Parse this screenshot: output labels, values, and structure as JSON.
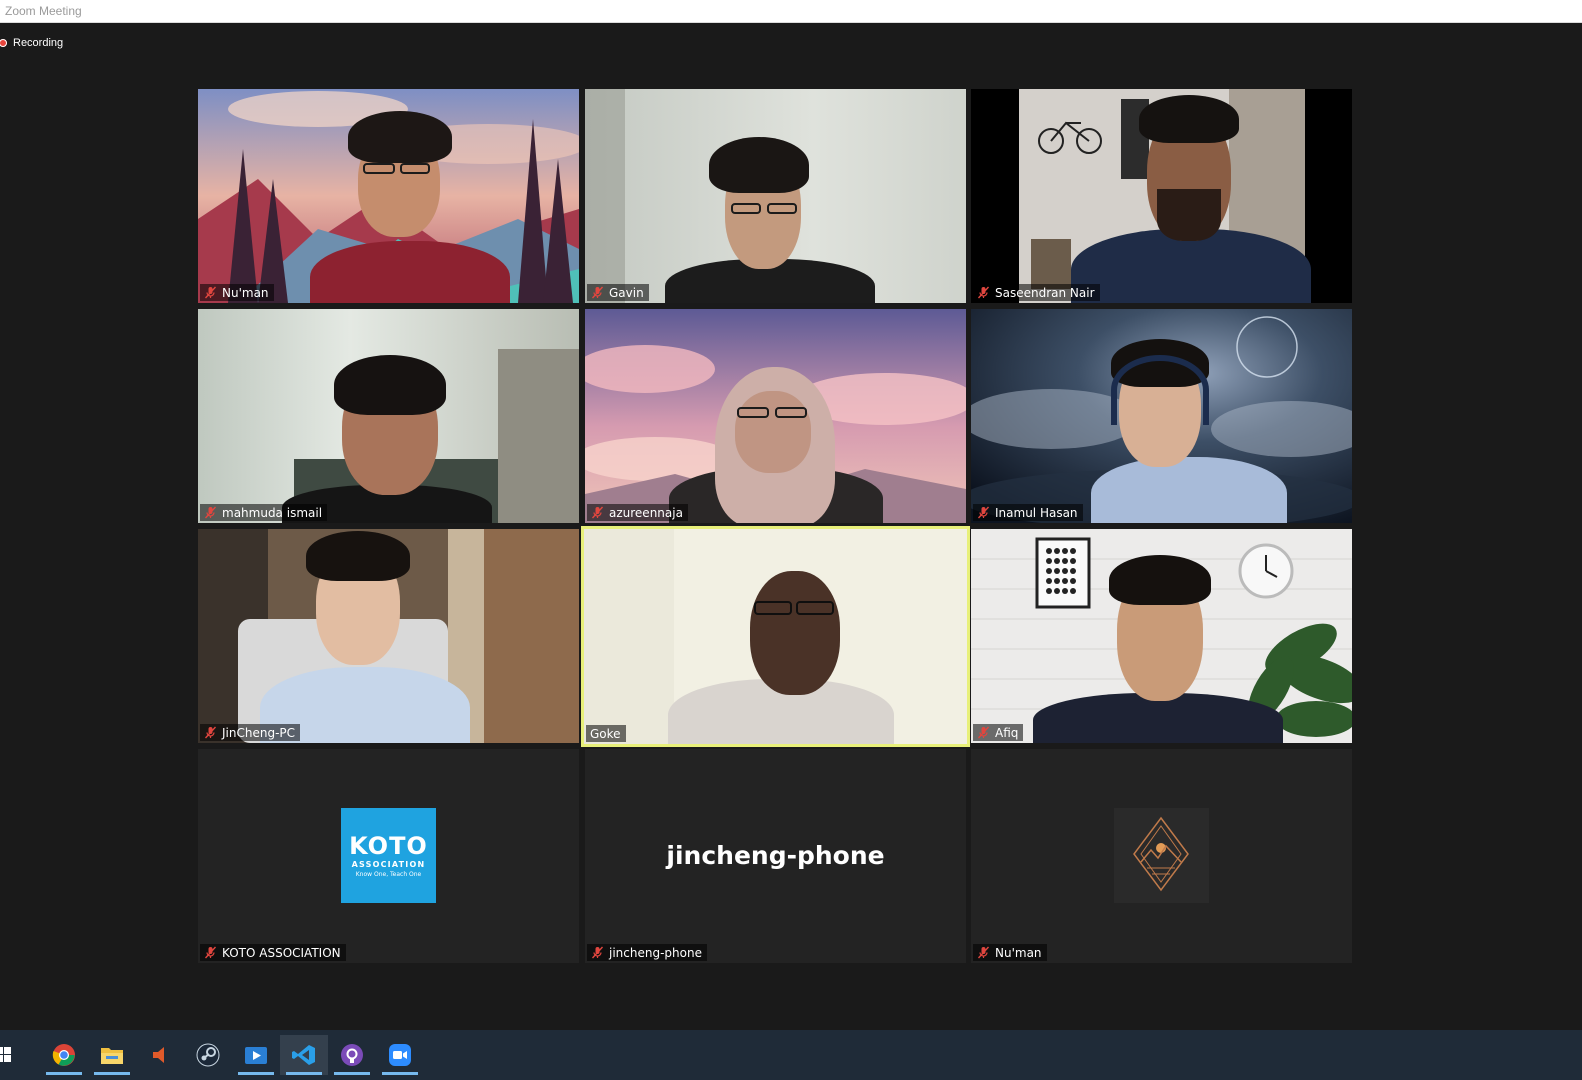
{
  "window": {
    "title": "Zoom Meeting"
  },
  "recording": {
    "label": "Recording"
  },
  "participants": [
    {
      "name": "Nu'man"
    },
    {
      "name": "Gavin"
    },
    {
      "name": "Saseendran Nair"
    },
    {
      "name": "mahmuda ismail"
    },
    {
      "name": "azureennaja"
    },
    {
      "name": "Inamul Hasan"
    },
    {
      "name": "JinCheng-PC"
    },
    {
      "name": "Goke"
    },
    {
      "name": "Afiq"
    },
    {
      "name": "KOTO ASSOCIATION"
    },
    {
      "name": "jincheng-phone"
    },
    {
      "name": "Nu'man"
    }
  ],
  "koto_logo": {
    "line1": "KOTO",
    "line2": "ASSOCIATION",
    "line3": "Know One, Teach One"
  },
  "phone_tile": {
    "display_text": "jincheng-phone"
  },
  "colors": {
    "active_speaker_border": "#e8f07a",
    "koto_blue": "#1fa3e0",
    "mic_muted": "#e0463f",
    "taskbar": "#1f2b38"
  },
  "taskbar": {
    "items": [
      {
        "icon": "windows-start-icon"
      },
      {
        "icon": "chrome-icon"
      },
      {
        "icon": "file-explorer-icon"
      },
      {
        "icon": "audio-app-icon"
      },
      {
        "icon": "steam-icon"
      },
      {
        "icon": "media-player-icon"
      },
      {
        "icon": "vscode-icon"
      },
      {
        "icon": "github-desktop-icon"
      },
      {
        "icon": "zoom-icon"
      }
    ]
  }
}
